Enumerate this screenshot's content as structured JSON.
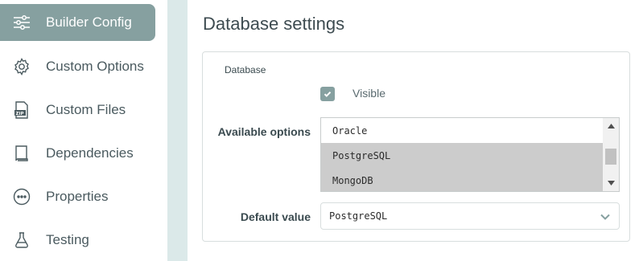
{
  "sidebar": {
    "items": [
      {
        "label": "Builder Config",
        "icon": "sliders-icon",
        "active": true
      },
      {
        "label": "Custom Options",
        "icon": "gear-icon",
        "active": false
      },
      {
        "label": "Custom Files",
        "icon": "zip-file-icon",
        "active": false
      },
      {
        "label": "Dependencies",
        "icon": "book-icon",
        "active": false
      },
      {
        "label": "Properties",
        "icon": "more-circle-icon",
        "active": false
      },
      {
        "label": "Testing",
        "icon": "flask-icon",
        "active": false
      }
    ]
  },
  "main": {
    "title": "Database settings",
    "section": "Database",
    "visible_checkbox": {
      "label": "Visible",
      "checked": true
    },
    "available_options": {
      "label": "Available options",
      "options": [
        {
          "value": "Oracle",
          "selected": false
        },
        {
          "value": "PostgreSQL",
          "selected": true
        },
        {
          "value": "MongoDB",
          "selected": true
        }
      ]
    },
    "default_value": {
      "label": "Default value",
      "value": "PostgreSQL"
    }
  },
  "colors": {
    "accent": "#86a0a0",
    "divider": "#dbe9e9",
    "selected_option": "#cccccc"
  }
}
